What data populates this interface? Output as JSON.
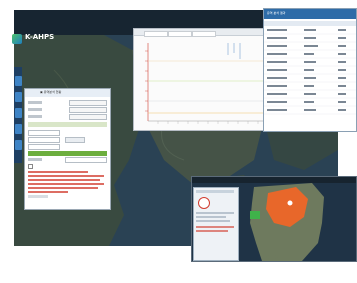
{
  "app": {
    "logo_text": "K-AHPS"
  },
  "colors": {
    "topbar": "#16232f",
    "rail": "#1e3f63",
    "rail_button": "#3e84c6",
    "accent_green": "#6cae3e",
    "warning_red": "#d23c2f",
    "table_header": "#2e6ca8",
    "highlight_orange": "#e8672a"
  },
  "icons": {
    "logo": "k-ahps-logo-icon",
    "close": "close-icon",
    "location": "map-pin-icon"
  },
  "left_panel": {
    "title": "▣ 유역분석 현황"
  },
  "table_window": {
    "title": "유역 분석 결과"
  }
}
